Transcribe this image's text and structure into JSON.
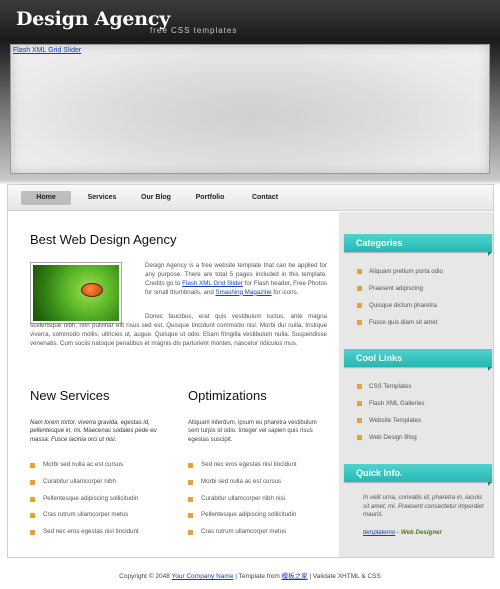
{
  "header": {
    "logo": "Design Agency",
    "tagline": "free CSS templates"
  },
  "slider": {
    "label": "Flash XML Grid Slider"
  },
  "nav": [
    {
      "label": "Home"
    },
    {
      "label": "Services"
    },
    {
      "label": "Our Blog"
    },
    {
      "label": "Portfolio"
    },
    {
      "label": "Contact"
    }
  ],
  "main": {
    "title": "Best Web Design Agency",
    "intro_prefix": "Design Agency is a free website template that can be applied for any purpose. There are total 5 pages included in this template. Credits go to ",
    "intro_link1": "Flash XML Grid Slider",
    "intro_mid": " for Flash header, Free Photos for small thumbnails, and ",
    "intro_link2": "Smashing Magazine",
    "intro_suffix": " for icons.",
    "intro_para2": "Donec faucibus, erat quis vestibulum luctus, ante magna scelerisque nibh, non pulvinar elit risus sed est. Quisque tincidunt commodo nisl. Morbi dui nulla, tristique viverra, commodo mollis, ultricies ut, augue. Quisque ut odio. Etiam fringilla vestibulum nulla. Suspendisse venenatis. Cum sociis natoque penatibus et magnis dis parturient montes, nascetur ridiculus mus."
  },
  "services": {
    "title": "New Services",
    "text": "Nam lorem tortor, viverra gravida, egestas id, pellentesque in, mi. Maecenas sodales pede eu massa. Fusce lacinia orci ut nisi.",
    "items": [
      "Morbi sed nulla ac est cursus",
      "Curabitur ullamcorper nibh",
      "Pellentesque adipiscing sollicitudin",
      "Cras rutrum ullamcorper metus",
      "Sed nec eros egestas nisl tincidunt"
    ]
  },
  "optimizations": {
    "title": "Optimizations",
    "text": "Aliquam interdum, ipsum eu pharetra vestibulum sem turpis id odio. Integer vel sapien quis risus egestas suscipit.",
    "items": [
      "Sed nec eros egestas nisl tincidunt",
      "Morbi sed nulla ac est cursus",
      "Curabitur ullamcorper nibh nisi",
      "Pellentesque adipiscing sollicitudin",
      "Cras rutrum ullamcorper metus"
    ]
  },
  "sidebar": {
    "categories": {
      "title": "Categories",
      "items": [
        "Aliquam pretium porta odio",
        "Praesent adipiscing",
        "Quisque dictum pharetra",
        "Fusce quis diam sit amet"
      ]
    },
    "links": {
      "title": "Cool Links",
      "items": [
        "CSS Templates",
        "Flash XML Galleries",
        "Website Templates",
        "Web Design Blog"
      ]
    },
    "quick": {
      "title": "Quick Info.",
      "text": "In velit urna, convallis id, pharetra in, iaculis sit amet, mi. Praesent consectetur imperdiet mauris.",
      "author": "templatemo",
      "role": " - Web Designer"
    }
  },
  "footer": {
    "prefix": "Copyright © 2048 ",
    "company": "Your Company Name",
    "mid": " | Template from ",
    "source": "模板之家",
    "suffix": " | Validate XHTML & CSS"
  },
  "colors": {
    "accent": "#2bbab6",
    "bullet": "#e5a23a",
    "link": "#1a3bbd"
  }
}
